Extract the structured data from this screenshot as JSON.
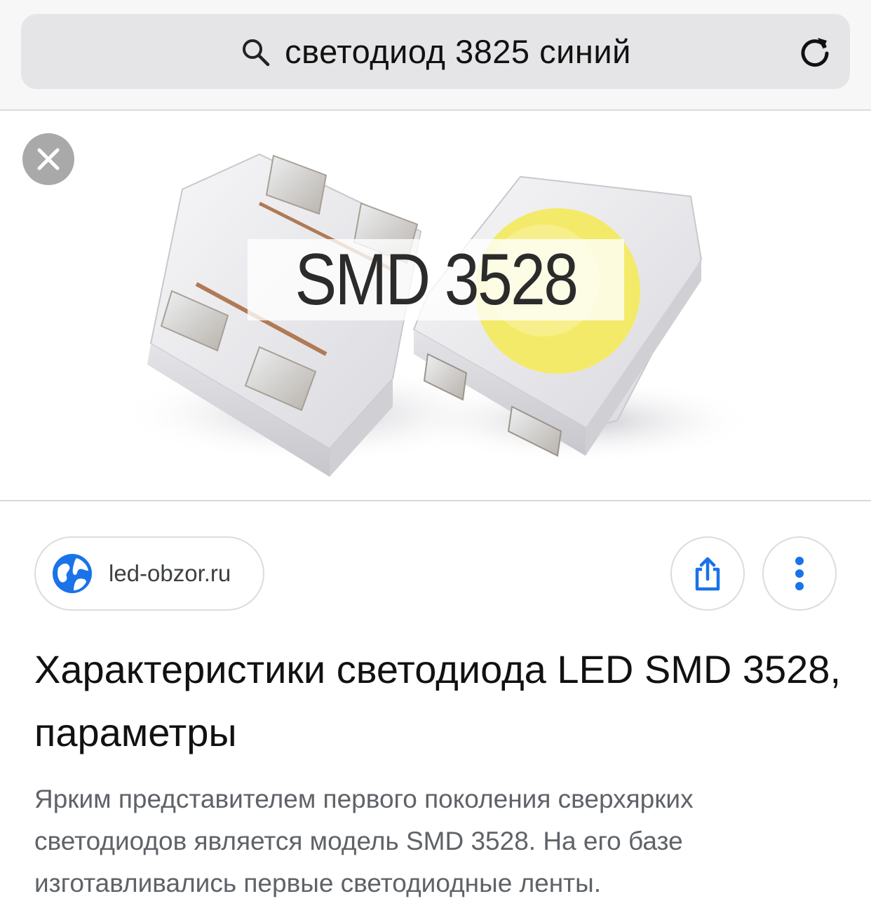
{
  "address_bar": {
    "query": "светодиод 3825 синий",
    "search_icon": "search-icon",
    "reload_icon": "reload-icon"
  },
  "image_viewer": {
    "close_icon": "close-icon",
    "image_label_text": "SMD 3528",
    "led_color": "#f4ea6a"
  },
  "result": {
    "site": "led-obzor.ru",
    "site_icon": "globe-icon",
    "share_icon": "share-icon",
    "more_icon": "more-vertical-icon",
    "title": "Характеристики светодиода LED SMD 3528, параметры",
    "snippet": "Ярким представителем первого поколения сверхярких светодиодов является модель SMD 3528. На его базе изготавливались первые светодиодные ленты."
  },
  "colors": {
    "accent_blue": "#1a73e8",
    "border": "#dadce0"
  }
}
